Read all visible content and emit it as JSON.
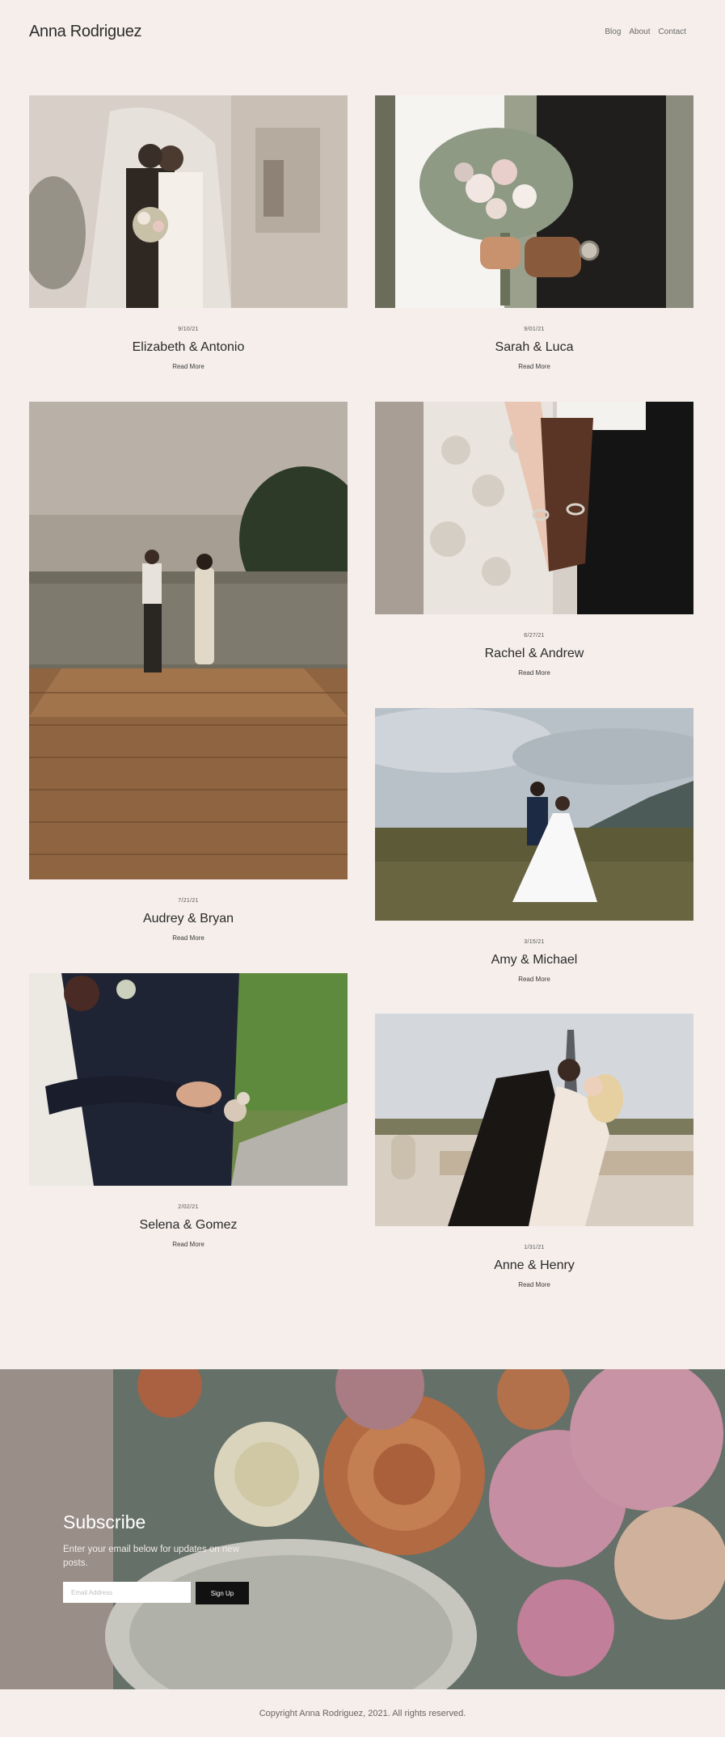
{
  "header": {
    "site_title": "Anna Rodriguez",
    "nav": [
      "Blog",
      "About",
      "Contact"
    ]
  },
  "posts": [
    {
      "date": "9/10/21",
      "title": "Elizabeth & Antonio",
      "read_more": "Read More"
    },
    {
      "date": "9/01/21",
      "title": "Sarah & Luca",
      "read_more": "Read More"
    },
    {
      "date": "7/21/21",
      "title": "Audrey & Bryan",
      "read_more": "Read More"
    },
    {
      "date": "6/27/21",
      "title": "Rachel & Andrew",
      "read_more": "Read More"
    },
    {
      "date": "3/15/21",
      "title": "Amy & Michael",
      "read_more": "Read More"
    },
    {
      "date": "2/02/21",
      "title": "Selena & Gomez",
      "read_more": "Read More"
    },
    {
      "date": "1/31/21",
      "title": "Anne & Henry",
      "read_more": "Read More"
    }
  ],
  "subscribe": {
    "heading": "Subscribe",
    "text": "Enter your email below for updates on new posts.",
    "email_placeholder": "Email Address",
    "button_label": "Sign Up"
  },
  "footer": {
    "copyright": "Copyright Anna Rodriguez, 2021. All rights reserved."
  }
}
